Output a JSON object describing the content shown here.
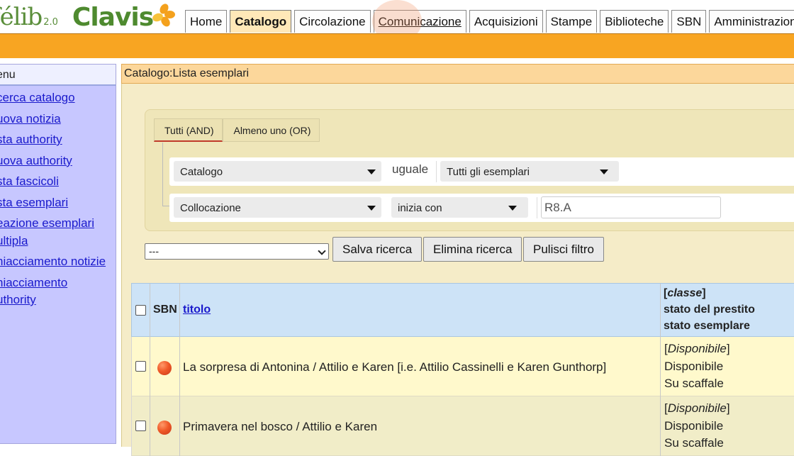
{
  "header": {
    "logo_cafe": "Caféli b",
    "logo_cafe_text": "féli",
    "logo_b": "b",
    "logo_version": "2.0",
    "logo_clavis": "Clavis",
    "tabs": [
      {
        "label": "Home"
      },
      {
        "label": "Catalogo"
      },
      {
        "label": "Circolazione"
      },
      {
        "label": "Comunicazione"
      },
      {
        "label": "Acquisizioni"
      },
      {
        "label": "Stampe"
      },
      {
        "label": "Biblioteche"
      },
      {
        "label": "SBN"
      },
      {
        "label": "Amministrazione"
      }
    ],
    "active_tab": "Catalogo"
  },
  "menu": {
    "title": "enu",
    "items": [
      {
        "label": "cerca catalogo"
      },
      {
        "label": "uova notizia"
      },
      {
        "label": "sta authority"
      },
      {
        "label": "uova authority"
      },
      {
        "label": "sta fascicoli"
      },
      {
        "label": "sta esemplari"
      },
      {
        "label": "eazione esemplari ultipla"
      },
      {
        "label": "hiacciamento notizie"
      },
      {
        "label": "hiacciamento uthority"
      }
    ]
  },
  "main": {
    "breadcrumb": "Catalogo:Lista esemplari",
    "filter": {
      "mode_and": "Tutti (AND)",
      "mode_or": "Almeno uno (OR)",
      "rule1": {
        "field": "Catalogo",
        "operator": "uguale",
        "value": "Tutti gli esemplari"
      },
      "rule2": {
        "field": "Collocazione",
        "operator": "inizia con",
        "value": "R8.A"
      }
    },
    "saved_search": {
      "selected": "---"
    },
    "buttons": {
      "save": "Salva ricerca",
      "delete": "Elimina ricerca",
      "clear": "Pulisci filtro"
    },
    "table": {
      "headers": {
        "sbn": "SBN",
        "title": "titolo",
        "status_l1_open": "[",
        "status_l1": "classe",
        "status_l1_close": "]",
        "status_l2": "stato del prestito",
        "status_l3": "stato esemplare"
      },
      "rows": [
        {
          "title": "La sorpresa di Antonina / Attilio e Karen [i.e. Attilio Cassinelli e Karen Gunthorp]",
          "class_open": "[",
          "class": "Disponibile",
          "class_close": "]",
          "loan_status": "Disponibile",
          "item_status": "Su scaffale"
        },
        {
          "title": "Primavera nel bosco / Attilio e Karen",
          "class_open": "[",
          "class": "Disponibile",
          "class_close": "]",
          "loan_status": "Disponibile",
          "item_status": "Su scaffale"
        }
      ]
    }
  },
  "colors": {
    "orange_bar": "#f8a522",
    "menu_bg": "#c7c7ff",
    "table_header": "#cde3f7",
    "row_a": "#fff9cc",
    "row_b": "#f1edc8",
    "link": "#1a1acc",
    "status_dot": "#f05a28"
  }
}
